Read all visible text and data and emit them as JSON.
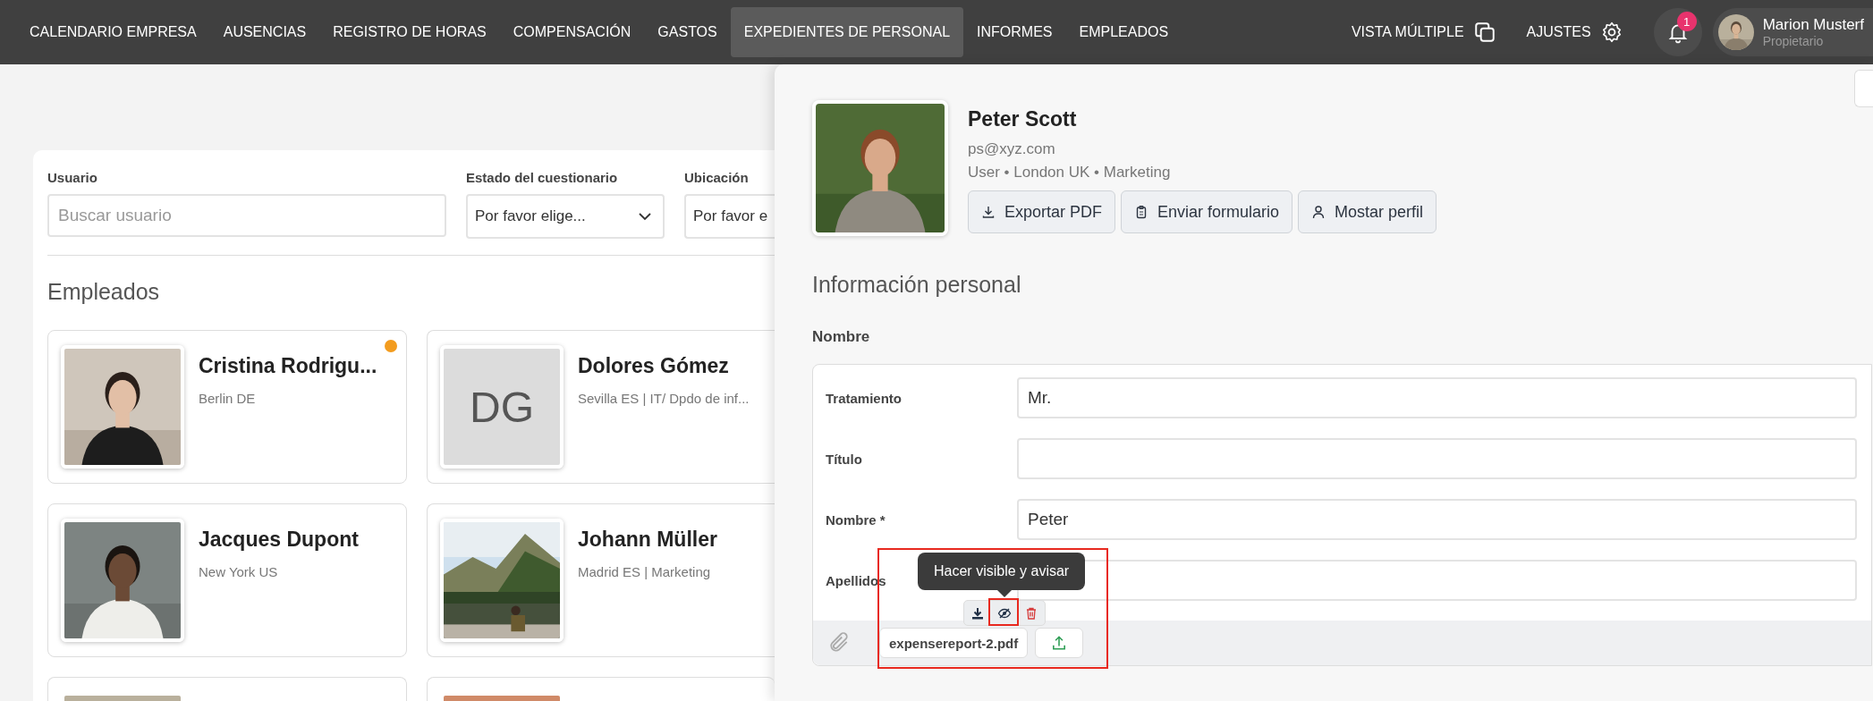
{
  "nav": {
    "items": [
      {
        "label": "CALENDARIO EMPRESA",
        "selected": false
      },
      {
        "label": "AUSENCIAS",
        "selected": false
      },
      {
        "label": "REGISTRO DE HORAS",
        "selected": false
      },
      {
        "label": "COMPENSACIÓN",
        "selected": false
      },
      {
        "label": "GASTOS",
        "selected": false
      },
      {
        "label": "EXPEDIENTES DE PERSONAL",
        "selected": true
      },
      {
        "label": "INFORMES",
        "selected": false
      },
      {
        "label": "EMPLEADOS",
        "selected": false
      }
    ],
    "multi_view": "VISTA MÚLTIPLE",
    "settings": "AJUSTES",
    "notification_count": "1",
    "user": {
      "name": "Marion Musterf",
      "role": "Propietario"
    }
  },
  "filters": [
    {
      "kind": "search",
      "label": "Usuario",
      "placeholder": "Buscar usuario"
    },
    {
      "kind": "select",
      "label": "Estado del cuestionario",
      "value": "Por favor elige..."
    },
    {
      "kind": "select",
      "label": "Ubicación",
      "value": "Por favor e"
    }
  ],
  "employees_title": "Empleados",
  "employees": [
    {
      "kind": "picture",
      "name": "Cristina Rodrigu...",
      "subtitle": "Berlin DE",
      "unread": true
    },
    {
      "kind": "initials",
      "initials": "DG",
      "name": "Dolores Gómez",
      "subtitle": "Sevilla ES | IT/ Dpdo de inf...",
      "unread": false
    },
    {
      "kind": "picture",
      "name": "Jacques Dupont",
      "subtitle": "New York US",
      "unread": false
    },
    {
      "kind": "picture",
      "name": "Johann Müller",
      "subtitle": "Madrid ES | Marketing",
      "unread": false
    },
    {
      "kind": "picture",
      "unread": false
    },
    {
      "kind": "picture",
      "unread": false
    }
  ],
  "profile": {
    "name": "Peter Scott",
    "email": "ps@xyz.com",
    "details": "User • London UK • Marketing",
    "buttons": [
      {
        "label": "Exportar PDF"
      },
      {
        "label": "Enviar formulario"
      },
      {
        "label": "Mostar perfil"
      }
    ]
  },
  "section_title": "Información personal",
  "group_title": "Nombre",
  "fields": [
    {
      "label": "Tratamiento",
      "value": "Mr."
    },
    {
      "label": "Título"
    },
    {
      "label": "Nombre *",
      "value": "Peter"
    },
    {
      "label": "Apellidos"
    }
  ],
  "attachment": {
    "filename": "expensereport-2.pdf",
    "tooltip": "Hacer visible y avisar"
  }
}
